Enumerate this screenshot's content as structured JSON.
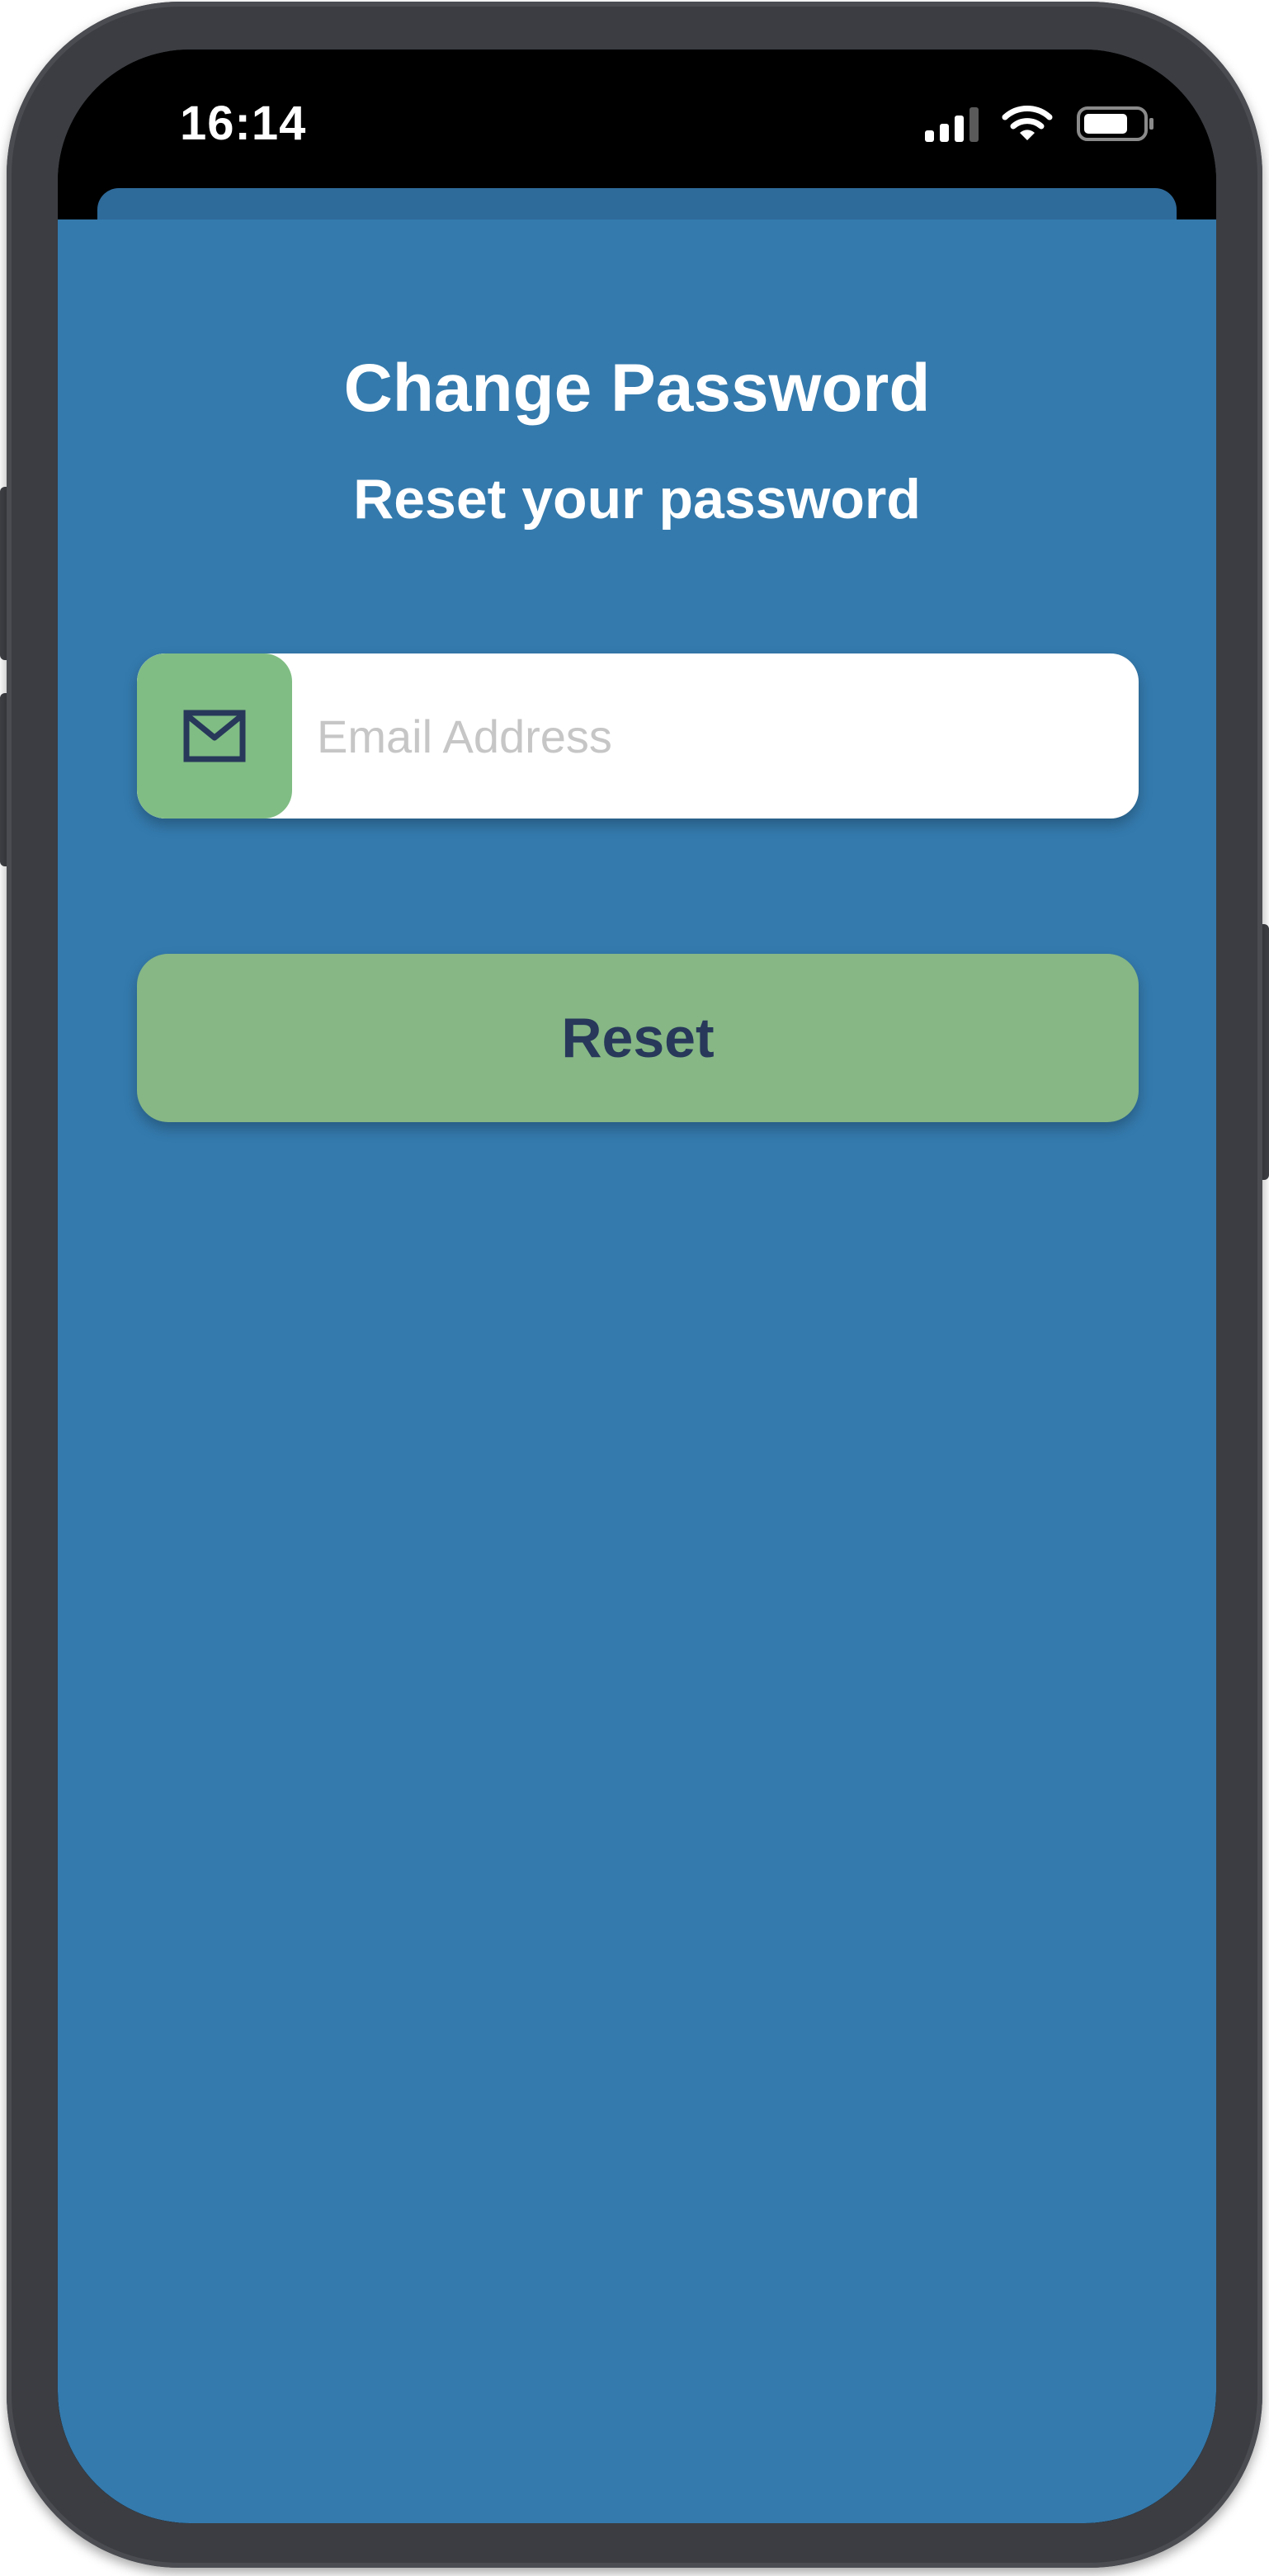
{
  "status_bar": {
    "time": "16:14",
    "signal_icon": "cellular-signal-icon",
    "wifi_icon": "wifi-icon",
    "battery_icon": "battery-icon"
  },
  "screen": {
    "title": "Change Password",
    "subtitle": "Reset your password"
  },
  "form": {
    "email_icon": "envelope-icon",
    "email_placeholder": "Email Address",
    "email_value": "",
    "reset_label": "Reset"
  },
  "colors": {
    "background": "#347aad",
    "accent_green": "#86b785",
    "button_text": "#27385a",
    "device_frame": "#3b3d42"
  }
}
